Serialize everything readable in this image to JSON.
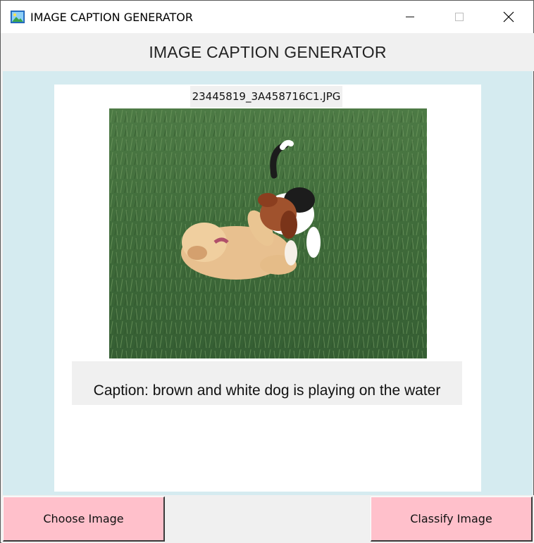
{
  "window": {
    "title": "IMAGE CAPTION GENERATOR",
    "app_icon": "picture-icon",
    "controls": [
      "minimize-icon",
      "maximize-icon",
      "close-icon"
    ]
  },
  "header": {
    "heading": "IMAGE CAPTION GENERATOR"
  },
  "image_panel": {
    "filename": "23445819_3A458716C1.JPG",
    "photo": "two-puppies-playing-on-grass"
  },
  "caption": {
    "text": "Caption: brown and white dog is playing on the water"
  },
  "buttons": {
    "choose_label": "Choose Image",
    "classify_label": "Classify Image"
  },
  "colors": {
    "content_bg": "#d5ebf0",
    "button_bg": "#ffc0cb",
    "panel_bg": "#ffffff"
  }
}
